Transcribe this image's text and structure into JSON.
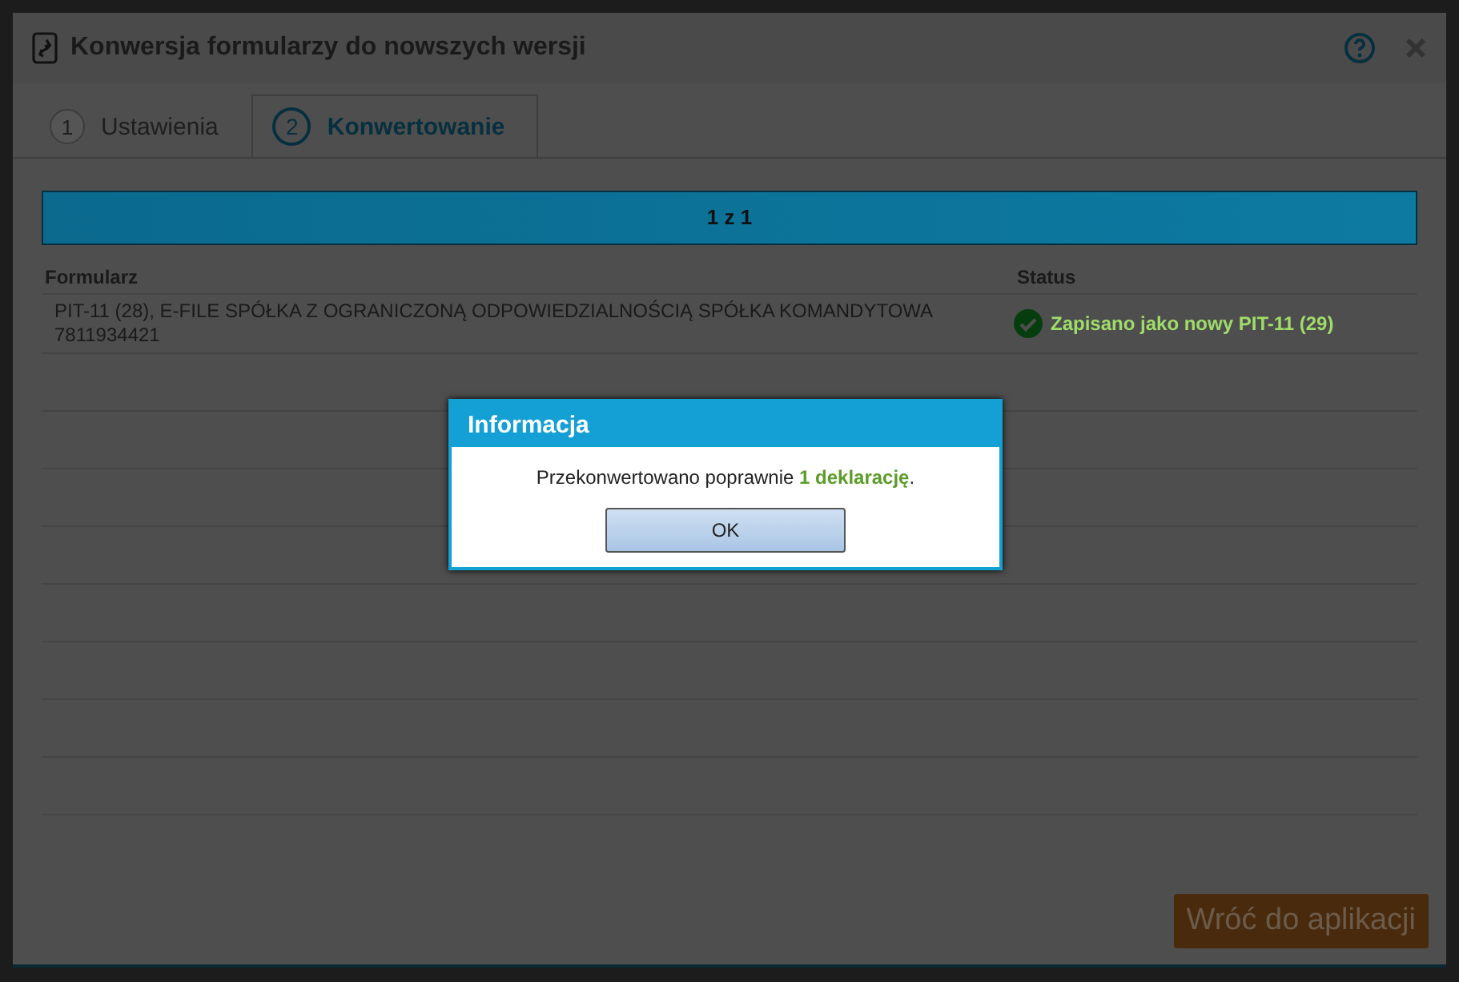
{
  "dialog": {
    "title": "Konwersja formularzy do nowszych wersji",
    "tabs": [
      {
        "number": "1",
        "label": "Ustawienia",
        "selected": false
      },
      {
        "number": "2",
        "label": "Konwertowanie",
        "selected": true
      }
    ],
    "progress": {
      "label": "1 z 1",
      "level": 1
    },
    "table": {
      "columns": [
        "Formularz",
        "Status"
      ],
      "rows": [
        {
          "form": "PIT-11 (28), E-FILE SPÓŁKA Z OGRANICZONĄ ODPOWIEDZIALNOŚCIĄ SPÓŁKA KOMANDYTOWA 7811934421",
          "status": "Zapisano jako nowy PIT-11 (29)",
          "kind": "success"
        }
      ]
    },
    "back_button": "Wróć do aplikacji"
  },
  "info_dialog": {
    "title": "Informacja",
    "message": "Przekonwertowano poprawnie **1 deklarację**.",
    "ok_button": "OK"
  }
}
